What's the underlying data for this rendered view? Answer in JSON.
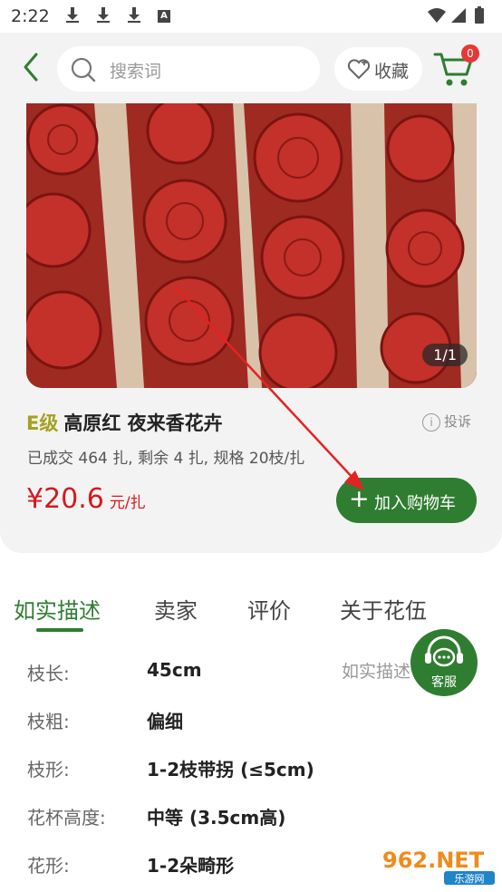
{
  "status_bar": {
    "time": "2:22"
  },
  "header": {
    "search_placeholder": "搜索词",
    "favorite_label": "收藏",
    "cart_count": "0"
  },
  "gallery": {
    "pager": "1/1"
  },
  "product": {
    "grade": "E级",
    "name": "高原红 夜来香花卉",
    "report_label": "投诉",
    "meta": "已成交 464 扎, 剩余 4 扎, 规格 20枝/扎",
    "price": "¥20.6",
    "price_unit": "元/扎",
    "add_cart_label": "加入购物车"
  },
  "tabs": [
    "如实描述",
    "卖家",
    "评价",
    "关于花伍"
  ],
  "specs": [
    {
      "label": "枝长:",
      "value": "45cm"
    },
    {
      "label": "枝粗:",
      "value": "偏细"
    },
    {
      "label": "枝形:",
      "value": "1-2枝带拐 (≤5cm)"
    },
    {
      "label": "花杯高度:",
      "value": "中等 (3.5cm高)"
    },
    {
      "label": "花形:",
      "value": "1-2朵畸形"
    }
  ],
  "description_label": "如实描述",
  "service_label": "客服",
  "watermark": {
    "brand": "962.NET",
    "sub": "乐游网"
  },
  "colors": {
    "accent_green": "#2f7d31",
    "price_red": "#d6181f",
    "grade_olive": "#a5a11f",
    "badge_red": "#e53935"
  }
}
